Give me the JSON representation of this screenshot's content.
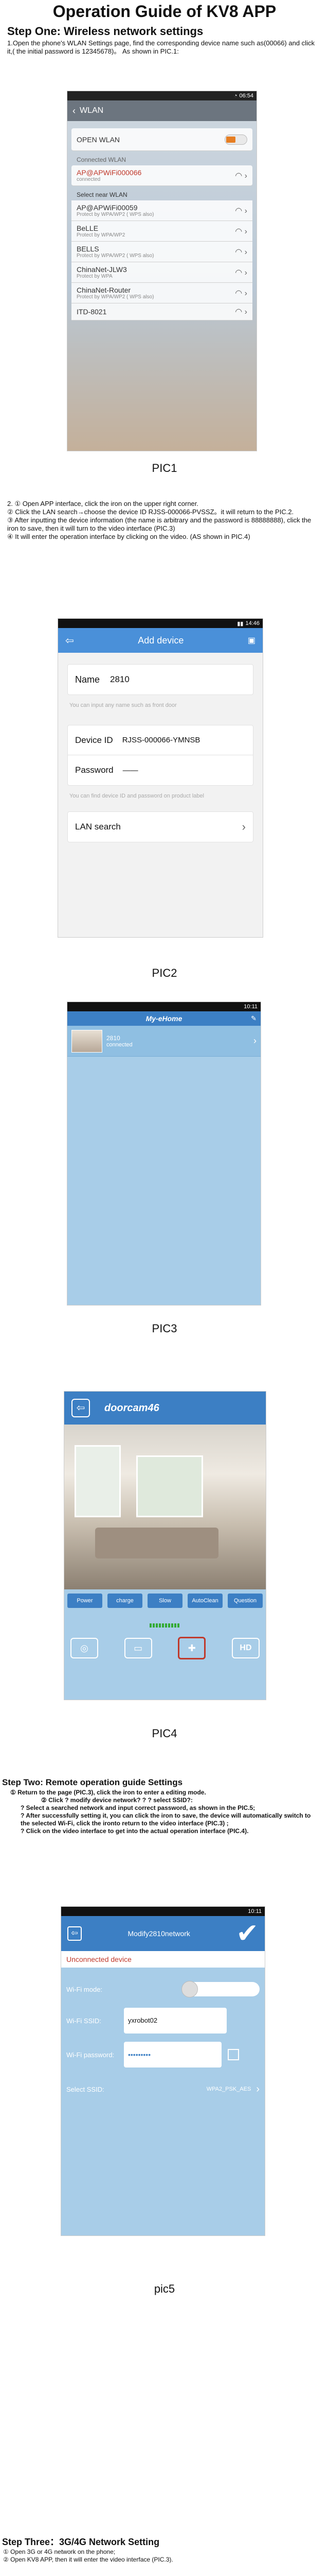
{
  "doc": {
    "title": "Operation Guide of KV8 APP",
    "step1_heading": "Step One: Wireless network settings",
    "step1_intro": "1.Open the phone's WLAN Settings page, find the corresponding device name such as(00066) and click it,( the initial password is 12345678)。 As shown in PIC.1:",
    "pic1_caption": "PIC1",
    "instructions": [
      "2.      ① Open APP interface, click the iron on the upper right corner.",
      "② Click the LAN search→choose the device ID RJSS-000066-PVSSZ。it will return to the PIC.2.",
      "③ After inputting the device information (the name is arbitrary and the password is 88888888), click the iron to save, then it will turn to the video interface (PIC.3)",
      "④ It will enter the operation interface by clicking on the video. (AS shown in PIC.4)"
    ],
    "pic2_caption": "PIC2",
    "pic3_caption": "PIC3",
    "pic4_caption": "PIC4",
    "step2_heading": "Step Two: Remote operation guide Settings",
    "step2_lines": [
      "① Return to the page (PIC.3), click the iron to enter a editing mode.",
      "② Click ? modify device network? ? ? select SSID?:",
      "? Select a searched network and input correct password, as shown in the PIC.5;",
      "? After successfully setting it, you can click the iron to save, the device will automatically switch to the selected Wi-Fi, click the ironto return to the video interface (PIC.3) ;",
      "? Click on the video interface to get into the actual operation interface (PIC.4)."
    ],
    "pic5_caption": "pic5",
    "step3_heading": "Step Three：3G/4G Network Setting",
    "step3_lines": [
      "① Open 3G or 4G network on the phone;",
      "②      Open KV8 APP, then it will enter the video interface (PIC.3)."
    ]
  },
  "pic1": {
    "status": "06:54",
    "title": "WLAN",
    "open_wlan": "OPEN WLAN",
    "connected_label": "Connected WLAN",
    "connected_name": "AP@APWiFi000066",
    "connected_sub": "connected",
    "select_label": "Select near WLAN",
    "networks": [
      {
        "name": "AP@APWiFi00059",
        "sub": "Protect by WPA/WP2 ( WPS also)"
      },
      {
        "name": "BeLLE",
        "sub": "Protect by WPA/WP2"
      },
      {
        "name": "BELLS",
        "sub": "Protect by WPA/WP2 ( WPS also)"
      },
      {
        "name": "ChinaNet-JLW3",
        "sub": "Protect by WPA"
      },
      {
        "name": "ChinaNet-Router",
        "sub": "Protect by WPA/WP2 ( WPS also)"
      },
      {
        "name": "ITD-8021",
        "sub": ""
      }
    ]
  },
  "pic2": {
    "status": "14:46",
    "title": "Add device",
    "name_label": "Name",
    "name_value": "2810",
    "name_hint": "You can input any name such as front door",
    "device_id_label": "Device ID",
    "device_id_value": "RJSS-000066-YMNSB",
    "password_label": "Password",
    "password_value": "——",
    "id_hint": "You can find device ID and password on product label",
    "lan_search": "LAN search"
  },
  "pic3": {
    "status": "10:11",
    "app_title": "My-eHome",
    "device_name": "2810",
    "device_status": "connected"
  },
  "pic4": {
    "title": "doorcam46",
    "buttons": [
      "Power",
      "charge",
      "Slow",
      "AutoClean",
      "Question"
    ],
    "hd_label": "HD"
  },
  "pic5": {
    "status": "10:11",
    "title": "Modify2810network",
    "section": "Unconnected device",
    "wifi_mode": "Wi-Fi mode:",
    "wifi_ssid_label": "Wi-Fi SSID:",
    "wifi_ssid_value": "yxrobot02",
    "wifi_pw_label": "Wi-Fi password:",
    "wifi_pw_value": "•••••••••",
    "select_ssid_label": "Select SSID:",
    "select_ssid_value": "WPA2_PSK_AES"
  },
  "colors": {
    "blue": "#4a90d9",
    "light_blue": "#a8cde8",
    "dark_blue": "#3c7fc4",
    "red": "#c0392b"
  }
}
